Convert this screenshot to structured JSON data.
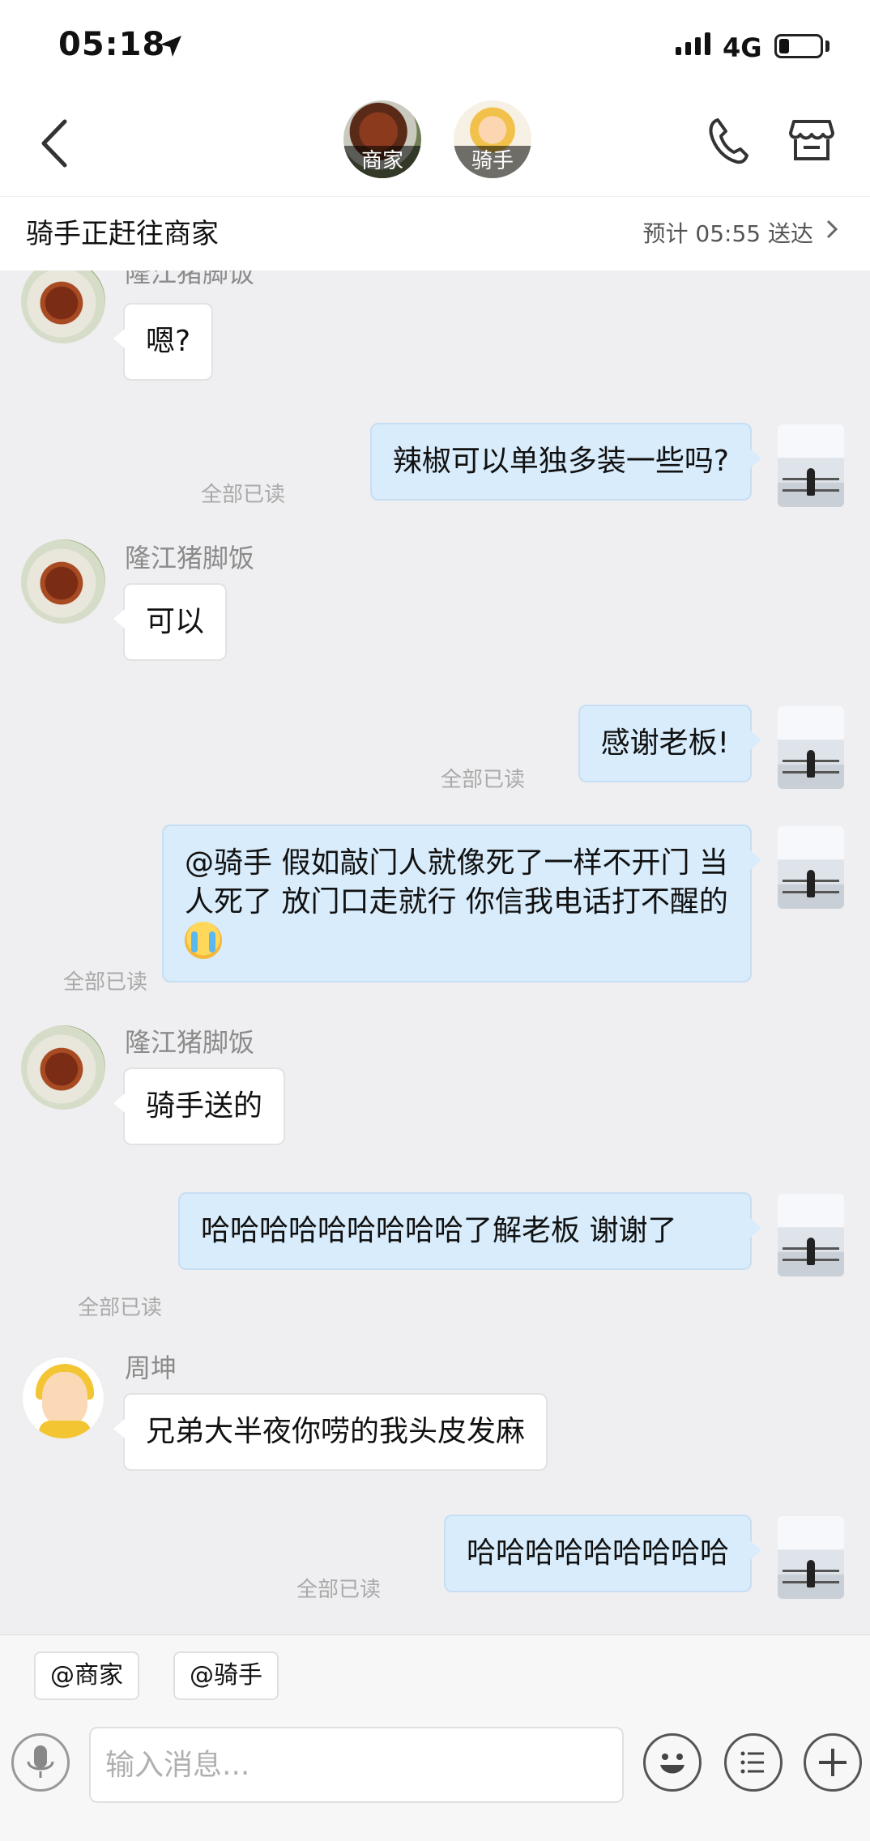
{
  "status_bar": {
    "time": "05:18",
    "network": "4G",
    "battery_level": 0.25
  },
  "header": {
    "merchant_label": "商家",
    "rider_label": "骑手"
  },
  "delivery": {
    "status": "骑手正赶往商家",
    "eta": "预计 05:55 送达"
  },
  "messages": [
    {
      "sender": "隆江猪脚饭",
      "direction": "in",
      "text": "嗯?"
    },
    {
      "direction": "out",
      "text": "辣椒可以单独多装一些吗?",
      "receipt": "全部已读"
    },
    {
      "sender": "隆江猪脚饭",
      "direction": "in",
      "text": "可以"
    },
    {
      "direction": "out",
      "text": "感谢老板!",
      "receipt": "全部已读"
    },
    {
      "direction": "out",
      "text": "@骑手 假如敲门人就像死了一样不开门 当人死了 放门口走就行 你信我电话打不醒的",
      "receipt": "全部已读"
    },
    {
      "sender": "隆江猪脚饭",
      "direction": "in",
      "text": "骑手送的"
    },
    {
      "direction": "out",
      "text": "哈哈哈哈哈哈哈哈哈了解老板 谢谢了",
      "receipt": "全部已读"
    },
    {
      "sender": "周坤",
      "direction": "in",
      "text": "兄弟大半夜你唠的我头皮发麻"
    },
    {
      "direction": "out",
      "text": "哈哈哈哈哈哈哈哈哈",
      "receipt": "全部已读"
    }
  ],
  "mentions": [
    "@商家",
    "@骑手"
  ],
  "composer": {
    "placeholder": "输入消息..."
  },
  "icons": {
    "back": "chevron-left-icon",
    "phone": "phone-icon",
    "shop": "store-icon",
    "mic": "microphone-icon",
    "emoji": "emoji-icon",
    "menu": "list-icon",
    "plus": "plus-icon"
  }
}
